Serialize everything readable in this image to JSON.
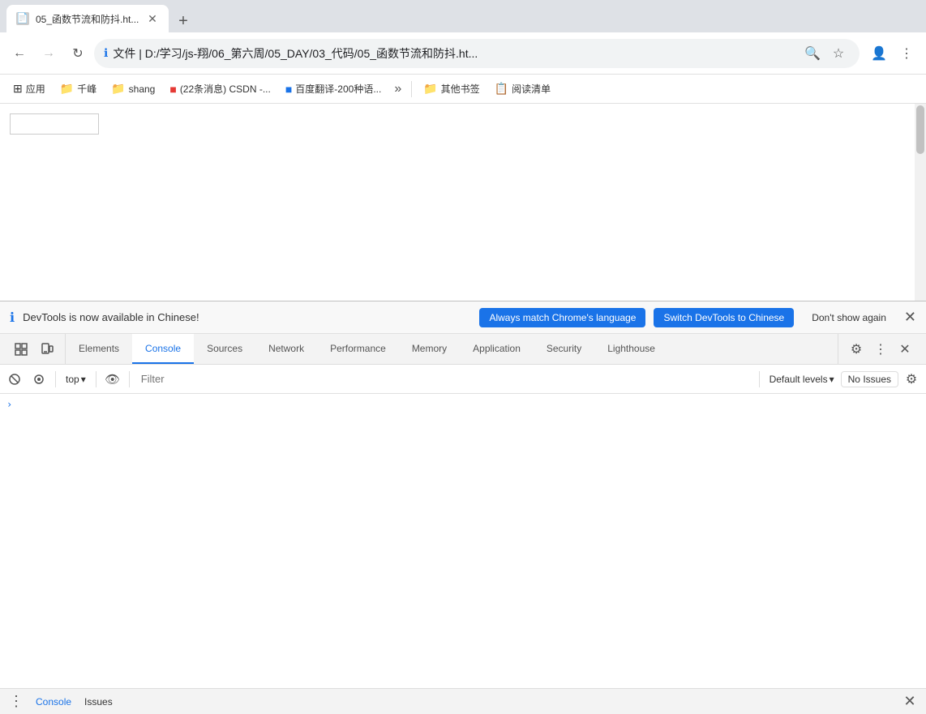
{
  "browser": {
    "tab": {
      "title": "05_函数节流和防抖.ht...",
      "favicon": "📄"
    },
    "nav": {
      "back_disabled": false,
      "forward_disabled": true,
      "url": "文件 | D:/学习/js-翔/06_第六周/05_DAY/03_代码/05_函数节流和防抖.ht...",
      "info_icon": "ℹ",
      "search_icon": "🔍",
      "bookmark_icon": "☆",
      "profile_icon": "👤",
      "more_icon": "⋮"
    },
    "bookmarks": [
      {
        "id": "apps",
        "label": "应用",
        "icon": "⊞"
      },
      {
        "id": "qianfeng",
        "label": "千峰",
        "icon": "📁"
      },
      {
        "id": "shang",
        "label": "shang",
        "icon": "📁"
      },
      {
        "id": "csdn",
        "label": "(22条消息) CSDN -...",
        "icon": "🔴"
      },
      {
        "id": "baidu",
        "label": "百度翻译-200种语...",
        "icon": "🔵"
      },
      {
        "id": "more",
        "label": "»",
        "icon": ""
      },
      {
        "id": "other",
        "label": "其他书签",
        "icon": "📁"
      },
      {
        "id": "reading",
        "label": "阅读清单",
        "icon": "📋"
      }
    ]
  },
  "page": {
    "search_placeholder": "",
    "search_value": ""
  },
  "devtools": {
    "notification": {
      "text": "DevTools is now available in Chinese!",
      "btn1": "Always match Chrome's language",
      "btn2": "Switch DevTools to Chinese",
      "btn3": "Don't show again"
    },
    "tabs": [
      {
        "id": "elements",
        "label": "Elements"
      },
      {
        "id": "console",
        "label": "Console",
        "active": true
      },
      {
        "id": "sources",
        "label": "Sources"
      },
      {
        "id": "network",
        "label": "Network"
      },
      {
        "id": "performance",
        "label": "Performance"
      },
      {
        "id": "memory",
        "label": "Memory"
      },
      {
        "id": "application",
        "label": "Application"
      },
      {
        "id": "security",
        "label": "Security"
      },
      {
        "id": "lighthouse",
        "label": "Lighthouse"
      }
    ],
    "console_toolbar": {
      "context": "top",
      "filter_placeholder": "Filter",
      "levels": "Default levels",
      "issues": "No Issues"
    },
    "bottom_tabs": [
      {
        "id": "console",
        "label": "Console",
        "active": true
      },
      {
        "id": "issues",
        "label": "Issues"
      }
    ],
    "icons": {
      "inspect": "⬚",
      "device": "⊡",
      "clear": "🚫",
      "eye": "👁",
      "settings": "⚙",
      "more": "⋮",
      "close": "✕",
      "chevron_down": "▾",
      "chevron_right": "›"
    }
  }
}
